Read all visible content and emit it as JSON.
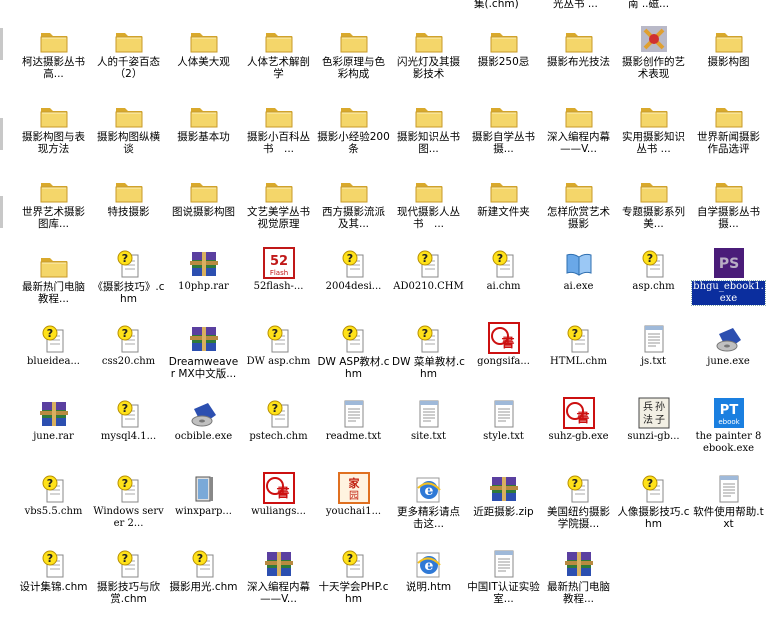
{
  "top_partial_labels": [
    "集(.chm)",
    "光丛书 ...",
    "南 ..磁..."
  ],
  "items": [
    {
      "label": "柯达摄影丛书　高...",
      "icon": "folder"
    },
    {
      "label": "人的千姿百态（2）",
      "icon": "folder"
    },
    {
      "label": "人体美大观",
      "icon": "folder"
    },
    {
      "label": "人体艺术解剖学",
      "icon": "folder"
    },
    {
      "label": "色彩原理与色彩构成",
      "icon": "folder"
    },
    {
      "label": "闪光灯及其摄影技术",
      "icon": "folder"
    },
    {
      "label": "摄影250忌",
      "icon": "folder"
    },
    {
      "label": "摄影布光技法",
      "icon": "folder"
    },
    {
      "label": "摄影创作的艺术表现",
      "icon": "folder-special"
    },
    {
      "label": "摄影构图",
      "icon": "folder"
    },
    {
      "label": "摄影构图与表现方法",
      "icon": "folder"
    },
    {
      "label": "摄影构图纵横谈",
      "icon": "folder"
    },
    {
      "label": "摄影基本功",
      "icon": "folder"
    },
    {
      "label": "摄影小百科丛书　...",
      "icon": "folder"
    },
    {
      "label": "摄影小经验200条",
      "icon": "folder"
    },
    {
      "label": "摄影知识丛书　图...",
      "icon": "folder"
    },
    {
      "label": "摄影自学丛书　摄...",
      "icon": "folder"
    },
    {
      "label": "深入编程内幕——V...",
      "icon": "folder"
    },
    {
      "label": "实用摄影知识丛书 ...",
      "icon": "folder"
    },
    {
      "label": "世界新闻摄影作品选评",
      "icon": "folder"
    },
    {
      "label": "世界艺术摄影图库...",
      "icon": "folder"
    },
    {
      "label": "特技摄影",
      "icon": "folder"
    },
    {
      "label": "图说摄影构图",
      "icon": "folder"
    },
    {
      "label": "文艺美学丛书 视觉原理",
      "icon": "folder"
    },
    {
      "label": "西方摄影流派及其...",
      "icon": "folder"
    },
    {
      "label": "现代摄影人丛书　...",
      "icon": "folder"
    },
    {
      "label": "新建文件夹",
      "icon": "folder"
    },
    {
      "label": "怎样欣赏艺术摄影",
      "icon": "folder"
    },
    {
      "label": "专题摄影系列　美...",
      "icon": "folder"
    },
    {
      "label": "自学摄影丛书　摄...",
      "icon": "folder"
    },
    {
      "label": "最新热门电脑教程...",
      "icon": "folder"
    },
    {
      "label": "《摄影技巧》.chm",
      "icon": "chm"
    },
    {
      "label": "10php.rar",
      "icon": "rar"
    },
    {
      "label": "52flash-...",
      "icon": "flash"
    },
    {
      "label": "2004desi...",
      "icon": "chm"
    },
    {
      "label": "AD0210.CHM",
      "icon": "chm"
    },
    {
      "label": "ai.chm",
      "icon": "chm"
    },
    {
      "label": "ai.exe",
      "icon": "book-exe"
    },
    {
      "label": "asp.chm",
      "icon": "chm"
    },
    {
      "label": "bhgu_ebook1.exe",
      "icon": "ps",
      "selected": true
    },
    {
      "label": "blueidea...",
      "icon": "chm"
    },
    {
      "label": "css20.chm",
      "icon": "chm"
    },
    {
      "label": "Dreamweaver MX中文版...",
      "icon": "rar"
    },
    {
      "label": "DW asp.chm",
      "icon": "chm"
    },
    {
      "label": "DW ASP教材.chm",
      "icon": "chm"
    },
    {
      "label": "DW 菜单教材.chm",
      "icon": "chm"
    },
    {
      "label": "gongsifa...",
      "icon": "red-book"
    },
    {
      "label": "HTML.chm",
      "icon": "chm"
    },
    {
      "label": "js.txt",
      "icon": "txt"
    },
    {
      "label": "june.exe",
      "icon": "setup"
    },
    {
      "label": "june.rar",
      "icon": "rar"
    },
    {
      "label": "mysql4.1...",
      "icon": "chm"
    },
    {
      "label": "ocbible.exe",
      "icon": "setup"
    },
    {
      "label": "pstech.chm",
      "icon": "chm"
    },
    {
      "label": "readme.txt",
      "icon": "txt"
    },
    {
      "label": "site.txt",
      "icon": "txt"
    },
    {
      "label": "style.txt",
      "icon": "txt"
    },
    {
      "label": "suhz-gb.exe",
      "icon": "red-book"
    },
    {
      "label": "sunzi-gb...",
      "icon": "sunzi"
    },
    {
      "label": "the painter 8 ebook.exe",
      "icon": "pt"
    },
    {
      "label": "vbs5.5.chm",
      "icon": "chm"
    },
    {
      "label": "Windows server 2...",
      "icon": "chm"
    },
    {
      "label": "winxparp...",
      "icon": "winxp"
    },
    {
      "label": "wuliangs...",
      "icon": "red-book"
    },
    {
      "label": "youchai1...",
      "icon": "youchai"
    },
    {
      "label": "更多精彩请点击这...",
      "icon": "ie"
    },
    {
      "label": "近距摄影.zip",
      "icon": "rar"
    },
    {
      "label": "美国纽约摄影学院摄...",
      "icon": "chm"
    },
    {
      "label": "人像摄影技巧.chm",
      "icon": "chm"
    },
    {
      "label": "软件使用帮助.txt",
      "icon": "txt"
    },
    {
      "label": "设计集锦.chm",
      "icon": "chm"
    },
    {
      "label": "摄影技巧与欣赏.chm",
      "icon": "chm"
    },
    {
      "label": "摄影用光.chm",
      "icon": "chm"
    },
    {
      "label": "深入编程内幕——V...",
      "icon": "rar"
    },
    {
      "label": "十天学会PHP.chm",
      "icon": "chm"
    },
    {
      "label": "说明.htm",
      "icon": "ie"
    },
    {
      "label": "中国IT认证实验室...",
      "icon": "txt"
    },
    {
      "label": "最新热门电脑教程...",
      "icon": "rar"
    }
  ],
  "icon_text": {
    "flash": "Flash",
    "ps": "PS",
    "pt": "PT",
    "pt_sub": "ebook",
    "red_book": "書",
    "sunzi": "兵 孙 法 子",
    "youchai": "家 园"
  },
  "colors": {
    "folder": "#f4d66a",
    "folder_dark": "#d9a92c",
    "selection": "#0b2e9e"
  }
}
